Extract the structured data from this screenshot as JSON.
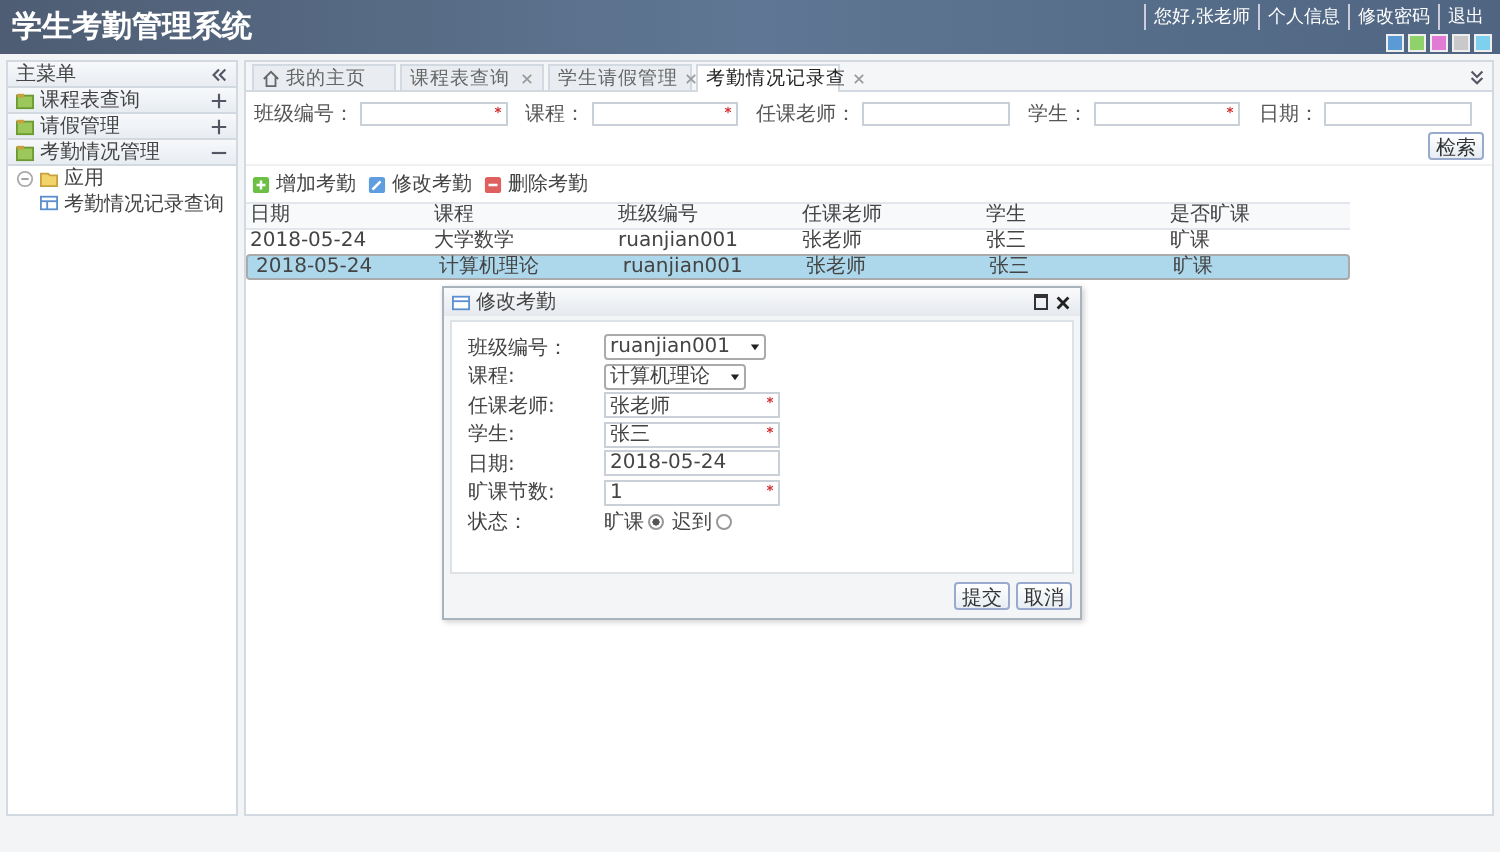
{
  "header": {
    "title": "学生考勤管理系统",
    "user_links": [
      "您好,张老师",
      "个人信息",
      "修改密码",
      "退出"
    ],
    "themes": [
      {
        "color": "#5b9bd5"
      },
      {
        "color": "#8fd16a"
      },
      {
        "color": "#e27bd6"
      },
      {
        "color": "#c9c9c9"
      },
      {
        "color": "#7fd0ee"
      }
    ]
  },
  "sidebar": {
    "title": "主菜单",
    "items": [
      {
        "label": "课程表查询",
        "expanded": false
      },
      {
        "label": "请假管理",
        "expanded": false
      },
      {
        "label": "考勤情况管理",
        "expanded": true,
        "children": [
          {
            "label": "应用",
            "expanded": true,
            "children": [
              {
                "label": "考勤情况记录查询",
                "selected": false
              }
            ]
          }
        ]
      }
    ]
  },
  "tabs": [
    {
      "label": "我的主页",
      "kind": "home",
      "selected": false
    },
    {
      "label": "课程表查询",
      "kind": "closable",
      "selected": false
    },
    {
      "label": "学生请假管理",
      "kind": "closable",
      "selected": false
    },
    {
      "label": "考勤情况记录查",
      "kind": "closable",
      "selected": true
    }
  ],
  "search": {
    "fields": [
      {
        "label": "班级编号：",
        "required": true
      },
      {
        "label": "课程：",
        "required": true
      },
      {
        "label": "任课老师：",
        "required": false
      },
      {
        "label": "学生：",
        "required": true
      },
      {
        "label": "日期：",
        "required": false
      }
    ],
    "button": "检索"
  },
  "toolbar": [
    {
      "label": "增加考勤",
      "kind": "add"
    },
    {
      "label": "修改考勤",
      "kind": "edit"
    },
    {
      "label": "删除考勤",
      "kind": "delete"
    }
  ],
  "table": {
    "columns": [
      "日期",
      "课程",
      "班级编号",
      "任课老师",
      "学生",
      "是否旷课"
    ],
    "rows": [
      {
        "cells": [
          "2018-05-24",
          "大学数学",
          "ruanjian001",
          "张老师",
          "张三",
          "旷课"
        ],
        "selected": false
      },
      {
        "cells": [
          "2018-05-24",
          "计算机理论",
          "ruanjian001",
          "张老师",
          "张三",
          "旷课"
        ],
        "selected": true
      }
    ]
  },
  "dialog": {
    "title": "修改考勤",
    "fields": [
      {
        "label": "班级编号：",
        "kind": "select",
        "value": "ruanjian001"
      },
      {
        "label": "课程:",
        "kind": "select",
        "value": "计算机理论"
      },
      {
        "label": "任课老师:",
        "kind": "text",
        "value": "张老师",
        "required": true
      },
      {
        "label": "学生:",
        "kind": "text",
        "value": "张三",
        "required": true
      },
      {
        "label": "日期:",
        "kind": "text",
        "value": "2018-05-24",
        "required": false
      },
      {
        "label": "旷课节数:",
        "kind": "text",
        "value": "1",
        "required": true
      }
    ],
    "status": {
      "label": "状态：",
      "options": [
        {
          "label": "旷课",
          "selected": true
        },
        {
          "label": "迟到",
          "selected": false
        }
      ]
    },
    "buttons": [
      "提交",
      "取消"
    ]
  }
}
